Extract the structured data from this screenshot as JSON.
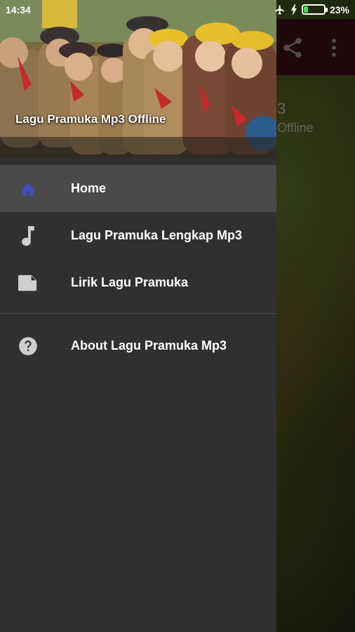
{
  "status_bar": {
    "time": "14:34",
    "battery_percent": "23%",
    "battery_level": 0.23,
    "icons": [
      "airplane-icon",
      "charging-icon",
      "battery-icon"
    ]
  },
  "app": {
    "title": "3",
    "subtitle": "Offline",
    "toolbar_icons": [
      "share-icon",
      "more-icon"
    ],
    "toolbar_color": "#3a0f16"
  },
  "drawer": {
    "header_title": "Lagu Pramuka Mp3 Offline",
    "items": [
      {
        "label": "Home",
        "icon": "home-icon",
        "active": true
      },
      {
        "label": "Lagu Pramuka Lengkap Mp3",
        "icon": "music-note-icon",
        "active": false
      },
      {
        "label": "Lirik Lagu Pramuka",
        "icon": "file-icon",
        "active": false
      },
      {
        "label": "About Lagu Pramuka Mp3",
        "icon": "help-icon",
        "active": false
      }
    ],
    "accent_color": "#3f51b5"
  }
}
